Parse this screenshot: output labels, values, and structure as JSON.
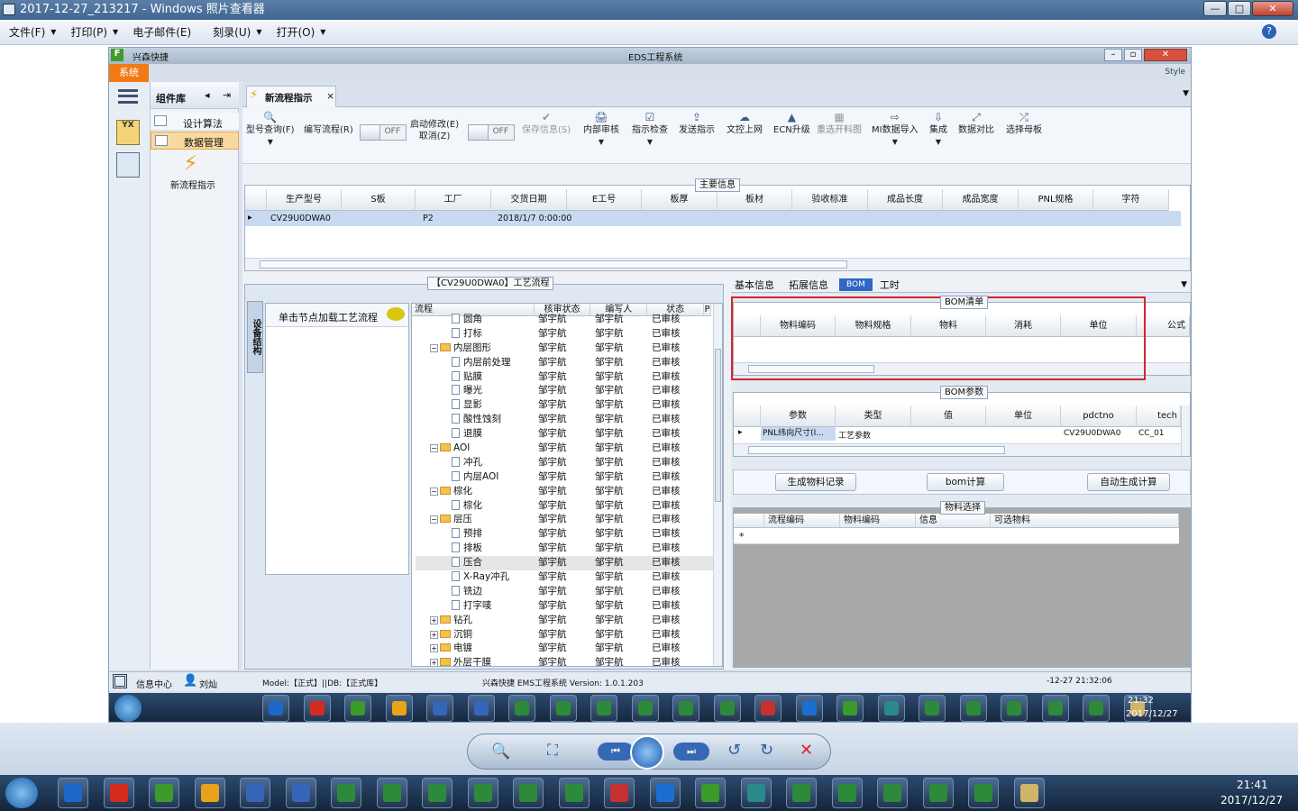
{
  "viewer": {
    "title": "2017-12-27_213217 - Windows 照片查看器",
    "menu": [
      "文件(F)",
      "打印(P)",
      "电子邮件(E)",
      "刻录(U)",
      "打开(O)"
    ],
    "controls": {
      "minimize": "—",
      "maximize": "□",
      "close": "✕"
    }
  },
  "app": {
    "logo_text": "兴森快捷",
    "window_title": "EDS工程系统",
    "style_label": "Style",
    "sys_tab": "系统",
    "complib": {
      "title": "组件库",
      "items": [
        "设计算法",
        "数据管理"
      ],
      "new_flow": "新流程指示"
    },
    "tab": {
      "label": "新流程指示",
      "close": "×"
    },
    "toolbar": {
      "buttons": [
        "型号查询(F)",
        "编写流程(R)",
        "启动修改(E)\n取消(Z)",
        "保存信息(S)",
        "内部审核",
        "指示检查",
        "发送指示",
        "文控上网",
        "ECN升级",
        "重选开料图",
        "MI数据导入",
        "集成",
        "数据对比",
        "选择母板"
      ],
      "toggle_off": "OFF"
    },
    "main_info": {
      "title": "主要信息",
      "columns": [
        "生产型号",
        "S板",
        "工厂",
        "交货日期",
        "E工号",
        "板厚",
        "板材",
        "验收标准",
        "成品长度",
        "成品宽度",
        "PNL规格",
        "字符"
      ],
      "rows": [
        [
          "CV29U0DWA0",
          "",
          "P2",
          "2018/1/7 0:00:00",
          "",
          "",
          "",
          "",
          "",
          "",
          "",
          ""
        ]
      ]
    },
    "process": {
      "title": "【CV29U0DWA0】工艺流程",
      "side_tab": "设备结构",
      "hint": "单击节点加载工艺流程",
      "columns": [
        "流程",
        "核审状态",
        "编写人",
        "状态",
        "P"
      ],
      "rows": [
        {
          "n": "圆角",
          "lvl": 2,
          "t": "doc"
        },
        {
          "n": "打标",
          "lvl": 2,
          "t": "doc"
        },
        {
          "n": "内层图形",
          "lvl": 1,
          "t": "fold"
        },
        {
          "n": "内层前处理",
          "lvl": 2,
          "t": "doc"
        },
        {
          "n": "贴膜",
          "lvl": 2,
          "t": "doc"
        },
        {
          "n": "曝光",
          "lvl": 2,
          "t": "doc"
        },
        {
          "n": "显影",
          "lvl": 2,
          "t": "doc"
        },
        {
          "n": "酸性蚀刻",
          "lvl": 2,
          "t": "doc"
        },
        {
          "n": "退膜",
          "lvl": 2,
          "t": "doc"
        },
        {
          "n": "AOI",
          "lvl": 1,
          "t": "fold"
        },
        {
          "n": "冲孔",
          "lvl": 2,
          "t": "doc"
        },
        {
          "n": "内层AOI",
          "lvl": 2,
          "t": "doc"
        },
        {
          "n": "棕化",
          "lvl": 1,
          "t": "fold"
        },
        {
          "n": "棕化",
          "lvl": 2,
          "t": "doc"
        },
        {
          "n": "层压",
          "lvl": 1,
          "t": "fold"
        },
        {
          "n": "预排",
          "lvl": 2,
          "t": "doc"
        },
        {
          "n": "排板",
          "lvl": 2,
          "t": "doc"
        },
        {
          "n": "压合",
          "lvl": 2,
          "t": "doc"
        },
        {
          "n": "X-Ray冲孔",
          "lvl": 2,
          "t": "doc"
        },
        {
          "n": "铣边",
          "lvl": 2,
          "t": "doc"
        },
        {
          "n": "打字唛",
          "lvl": 2,
          "t": "doc"
        },
        {
          "n": "钻孔",
          "lvl": 1,
          "t": "fold"
        },
        {
          "n": "沉铜",
          "lvl": 1,
          "t": "fold"
        },
        {
          "n": "电镀",
          "lvl": 1,
          "t": "fold"
        },
        {
          "n": "外层干膜",
          "lvl": 1,
          "t": "fold"
        }
      ],
      "auditor": "邹宇航",
      "writer": "邹宇航",
      "status": "已审核"
    },
    "right_tabs": [
      "基本信息",
      "拓展信息",
      "BOM",
      "工时"
    ],
    "bom_list": {
      "title": "BOM清单",
      "columns": [
        "物料编码",
        "物料规格",
        "物料",
        "消耗",
        "单位",
        "公式"
      ]
    },
    "bom_param": {
      "title": "BOM参数",
      "columns": [
        "参数",
        "类型",
        "值",
        "单位",
        "pdctno",
        "tech"
      ],
      "rows": [
        [
          "PNL纬向尺寸(I...",
          "工艺参数",
          "",
          "",
          "CV29U0DWA0",
          "CC_01"
        ]
      ]
    },
    "bom_buttons": [
      "生成物料记录",
      "bom计算",
      "自动生成计算"
    ],
    "material": {
      "title": "物料选择",
      "columns": [
        "流程编码",
        "物料编码",
        "信息",
        "可选物料"
      ],
      "new_row": "*"
    },
    "status": {
      "info_center": "信息中心",
      "user": "刘灿",
      "model": "Model:【正式】||DB:【正式库】",
      "version": "兴森快捷 EMS工程系统 Version: 1.0.1.203",
      "time": "-12-27 21:32:06"
    }
  },
  "inner_taskbar": {
    "time": "21:32",
    "date": "2017/12/27"
  },
  "outer_taskbar": {
    "time": "21:41",
    "date": "2017/12/27"
  }
}
